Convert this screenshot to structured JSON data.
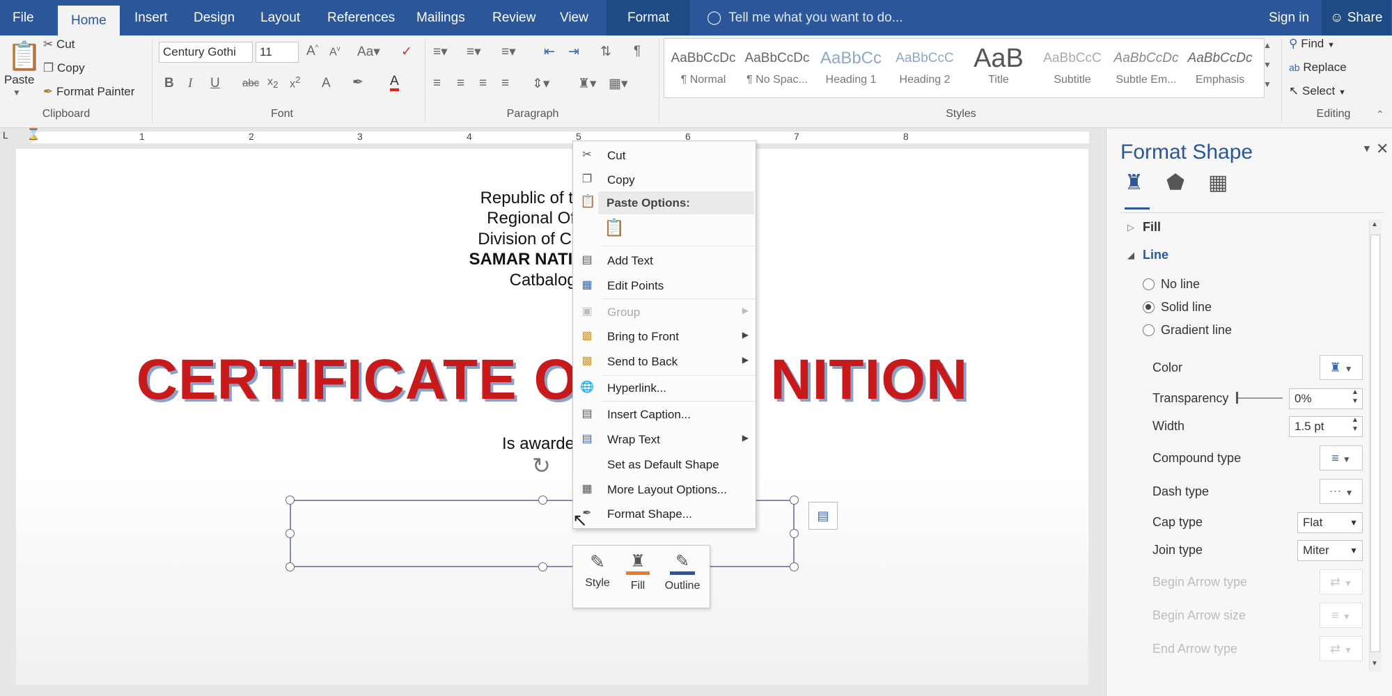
{
  "tabs": [
    "File",
    "Home",
    "Insert",
    "Design",
    "Layout",
    "References",
    "Mailings",
    "Review",
    "View",
    "Format"
  ],
  "tell_me": "Tell me what you want to do...",
  "sign_in": "Sign in",
  "share": "Share",
  "clipboard": {
    "paste": "Paste",
    "cut": "Cut",
    "copy": "Copy",
    "format_painter": "Format Painter",
    "label": "Clipboard"
  },
  "font": {
    "name": "Century Gothi",
    "size": "11",
    "label": "Font"
  },
  "paragraph": {
    "label": "Paragraph"
  },
  "styles": {
    "label": "Styles",
    "items": [
      {
        "preview": "AaBbCcDc",
        "name": "¶ Normal"
      },
      {
        "preview": "AaBbCcDc",
        "name": "¶ No Spac..."
      },
      {
        "preview": "AaBbCc",
        "name": "Heading 1"
      },
      {
        "preview": "AaBbCcC",
        "name": "Heading 2"
      },
      {
        "preview": "AaB",
        "name": "Title"
      },
      {
        "preview": "AaBbCcC",
        "name": "Subtitle"
      },
      {
        "preview": "AaBbCcDc",
        "name": "Subtle Em..."
      },
      {
        "preview": "AaBbCcDc",
        "name": "Emphasis"
      }
    ]
  },
  "editing": {
    "find": "Find",
    "replace": "Replace",
    "select": "Select",
    "label": "Editing"
  },
  "ruler_numbers": [
    "1",
    "2",
    "3",
    "4",
    "5",
    "6",
    "7",
    "8"
  ],
  "document": {
    "line1": "Republic of the Phil",
    "line2": "Regional Office N",
    "line3": "Division of Catbalog",
    "line4": "SAMAR NATIONAL S",
    "line5": "Catbalogan",
    "certificate": "CERTIFICATE OF R",
    "certificate_tail": "NITION",
    "awarded": "Is awarded to"
  },
  "context_menu": {
    "cut": "Cut",
    "copy": "Copy",
    "paste_options": "Paste Options:",
    "add_text": "Add Text",
    "edit_points": "Edit Points",
    "group": "Group",
    "bring_to_front": "Bring to Front",
    "send_to_back": "Send to Back",
    "hyperlink": "Hyperlink...",
    "insert_caption": "Insert Caption...",
    "wrap_text": "Wrap Text",
    "set_default": "Set as Default Shape",
    "more_layout": "More Layout Options...",
    "format_shape": "Format Shape..."
  },
  "mini_toolbar": {
    "style": "Style",
    "fill": "Fill",
    "outline": "Outline"
  },
  "pane": {
    "title": "Format Shape",
    "fill": "Fill",
    "line": "Line",
    "no_line": "No line",
    "solid_line": "Solid line",
    "gradient_line": "Gradient line",
    "color": "Color",
    "transparency": "Transparency",
    "transparency_value": "0%",
    "width": "Width",
    "width_value": "1.5 pt",
    "compound_type": "Compound type",
    "dash_type": "Dash type",
    "cap_type": "Cap type",
    "cap_value": "Flat",
    "join_type": "Join type",
    "join_value": "Miter",
    "begin_arrow_type": "Begin Arrow type",
    "begin_arrow_size": "Begin Arrow size",
    "end_arrow_type": "End Arrow type",
    "selected_line": "Solid line"
  },
  "colors": {
    "accent": "#2b579a",
    "cert_red": "#c81a1a"
  }
}
